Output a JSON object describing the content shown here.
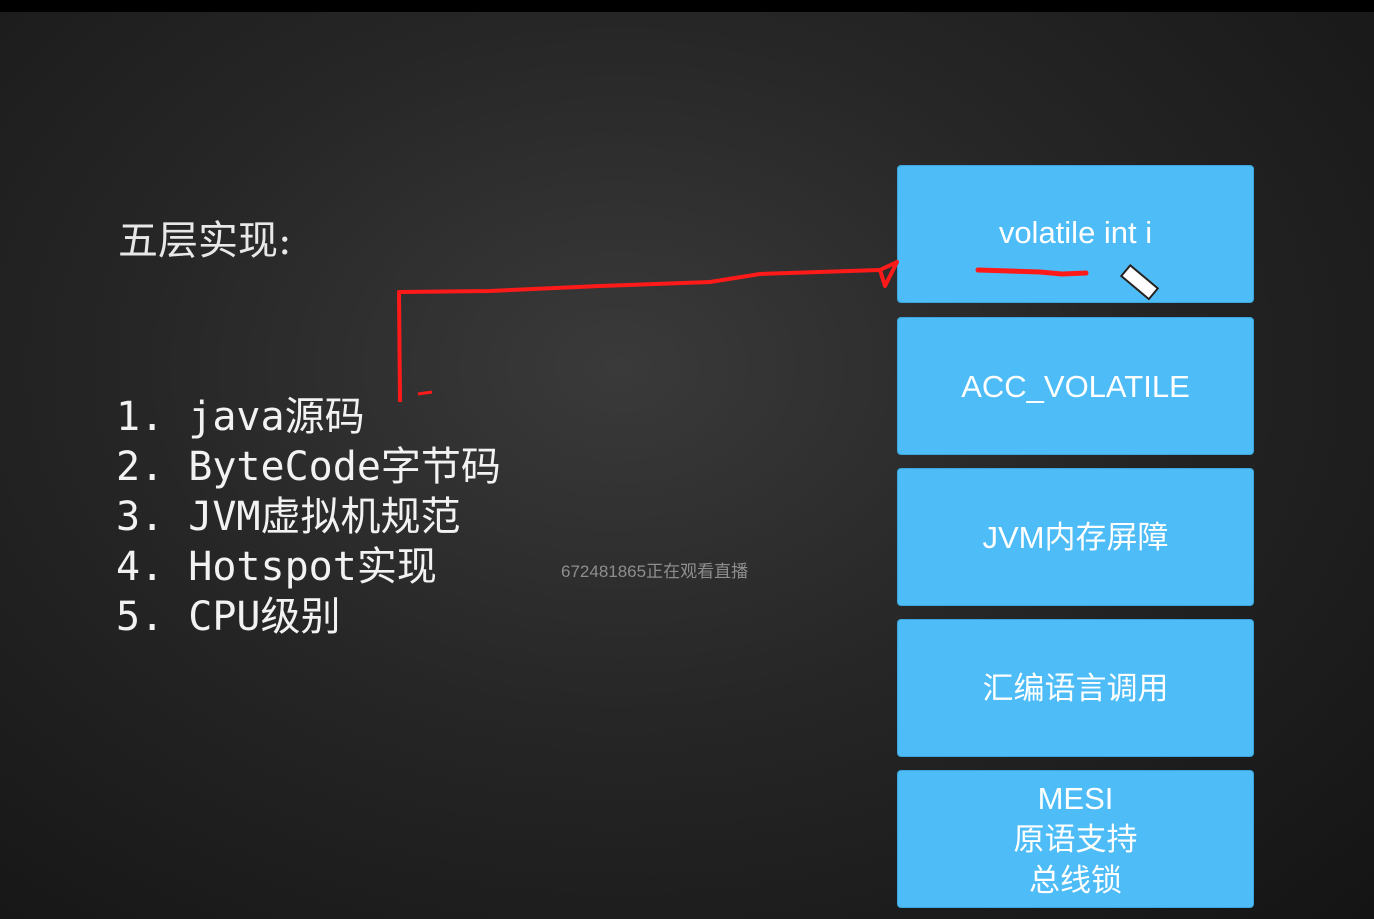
{
  "slide": {
    "title": "五层实现:",
    "list": [
      "1. java源码",
      "2. ByteCode字节码",
      "3. JVM虚拟机规范",
      "4. Hotspot实现",
      "5. CPU级别"
    ],
    "watermark": "672481865正在观看直播",
    "boxes": [
      {
        "lines": [
          "volatile int i"
        ]
      },
      {
        "lines": [
          "ACC_VOLATILE"
        ]
      },
      {
        "lines": [
          "JVM内存屏障"
        ]
      },
      {
        "lines": [
          "汇编语言调用"
        ]
      },
      {
        "lines": [
          "MESI",
          "原语支持",
          "总线锁"
        ]
      }
    ]
  },
  "colors": {
    "box": "#4dbcf7",
    "annotation": "#ff1a1a"
  }
}
